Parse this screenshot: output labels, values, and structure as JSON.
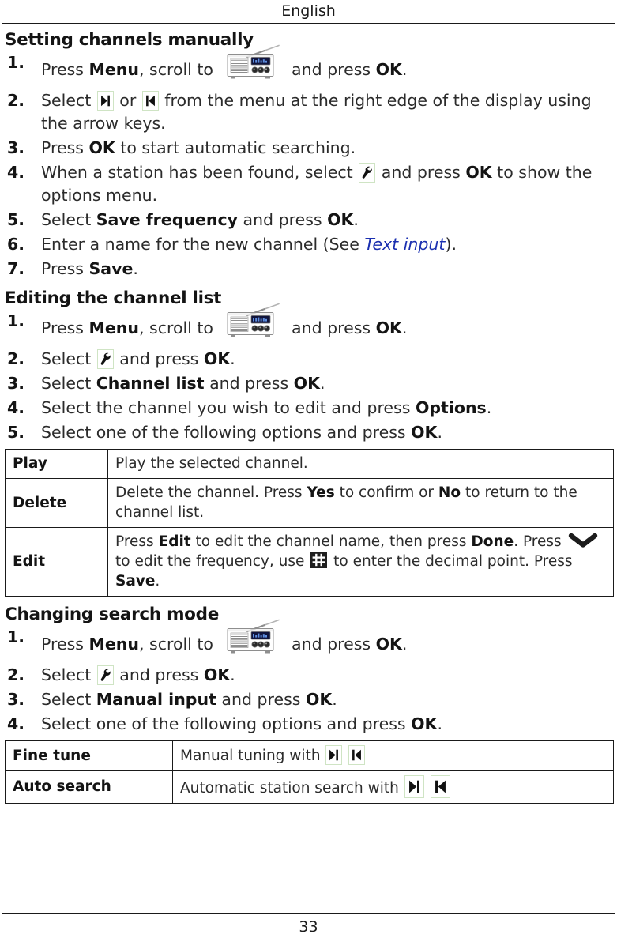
{
  "header": {
    "running_head": "English"
  },
  "footer": {
    "page_number": "33"
  },
  "colors": {
    "text": "#2b2b2b",
    "heading": "#141414",
    "link": "#1a2fb0",
    "icon_frame": "#cfe4c4",
    "rule": "#1a1a1a"
  },
  "sections": [
    {
      "title": "Setting channels manually",
      "steps": [
        {
          "num": "1.",
          "parts": [
            {
              "t": "Press "
            },
            {
              "t": "Menu",
              "bold": true
            },
            {
              "t": ", scroll to "
            },
            {
              "icon": "radio-icon"
            },
            {
              "t": " and press "
            },
            {
              "t": "OK",
              "bold": true
            },
            {
              "t": "."
            }
          ]
        },
        {
          "num": "2.",
          "parts": [
            {
              "t": "Select "
            },
            {
              "icon": "skip-forward-icon"
            },
            {
              "t": " or "
            },
            {
              "icon": "skip-back-icon"
            },
            {
              "t": " from the menu at the right edge of the display using the arrow keys."
            }
          ]
        },
        {
          "num": "3.",
          "parts": [
            {
              "t": "Press "
            },
            {
              "t": "OK",
              "bold": true
            },
            {
              "t": " to start automatic searching."
            }
          ]
        },
        {
          "num": "4.",
          "parts": [
            {
              "t": "When a station has been found, select "
            },
            {
              "icon": "wrench-icon"
            },
            {
              "t": " and press "
            },
            {
              "t": "OK",
              "bold": true
            },
            {
              "t": " to show the options menu."
            }
          ]
        },
        {
          "num": "5.",
          "parts": [
            {
              "t": "Select "
            },
            {
              "t": "Save frequency",
              "bold": true
            },
            {
              "t": " and press "
            },
            {
              "t": "OK",
              "bold": true
            },
            {
              "t": "."
            }
          ]
        },
        {
          "num": "6.",
          "parts": [
            {
              "t": "Enter a name for the new channel (See "
            },
            {
              "t": "Text input",
              "link": true
            },
            {
              "t": ")."
            }
          ]
        },
        {
          "num": "7.",
          "parts": [
            {
              "t": "Press "
            },
            {
              "t": "Save",
              "bold": true
            },
            {
              "t": "."
            }
          ]
        }
      ]
    },
    {
      "title": "Editing the channel list",
      "steps": [
        {
          "num": "1.",
          "parts": [
            {
              "t": "Press "
            },
            {
              "t": "Menu",
              "bold": true
            },
            {
              "t": ", scroll to "
            },
            {
              "icon": "radio-icon"
            },
            {
              "t": " and press "
            },
            {
              "t": "OK",
              "bold": true
            },
            {
              "t": "."
            }
          ]
        },
        {
          "num": "2.",
          "parts": [
            {
              "t": "Select "
            },
            {
              "icon": "wrench-icon"
            },
            {
              "t": " and press "
            },
            {
              "t": "OK",
              "bold": true
            },
            {
              "t": "."
            }
          ]
        },
        {
          "num": "3.",
          "parts": [
            {
              "t": "Select "
            },
            {
              "t": "Channel list",
              "bold": true
            },
            {
              "t": " and press "
            },
            {
              "t": "OK",
              "bold": true
            },
            {
              "t": "."
            }
          ]
        },
        {
          "num": "4.",
          "parts": [
            {
              "t": "Select the channel you wish to edit and press "
            },
            {
              "t": "Options",
              "bold": true
            },
            {
              "t": "."
            }
          ]
        },
        {
          "num": "5.",
          "parts": [
            {
              "t": "Select one of the following options and press "
            },
            {
              "t": "OK",
              "bold": true
            },
            {
              "t": "."
            }
          ]
        }
      ],
      "table": {
        "rows": [
          {
            "key": "Play",
            "parts": [
              {
                "t": "Play the selected channel."
              }
            ]
          },
          {
            "key": "Delete",
            "parts": [
              {
                "t": "Delete the channel. Press "
              },
              {
                "t": "Yes",
                "bold": true
              },
              {
                "t": " to confirm or "
              },
              {
                "t": "No",
                "bold": true
              },
              {
                "t": " to return to the channel list."
              }
            ]
          },
          {
            "key": "Edit",
            "parts": [
              {
                "t": "Press "
              },
              {
                "t": "Edit",
                "bold": true
              },
              {
                "t": " to edit the channel name, then press "
              },
              {
                "t": "Done",
                "bold": true
              },
              {
                "t": ". Press "
              },
              {
                "icon": "chevron-down-icon"
              },
              {
                "t": " to edit the frequency, use "
              },
              {
                "icon": "hash-key-icon"
              },
              {
                "t": " to enter the decimal point. Press "
              },
              {
                "t": "Save",
                "bold": true
              },
              {
                "t": "."
              }
            ]
          }
        ]
      }
    },
    {
      "title": "Changing search mode",
      "steps": [
        {
          "num": "1.",
          "parts": [
            {
              "t": "Press "
            },
            {
              "t": "Menu",
              "bold": true
            },
            {
              "t": ", scroll to "
            },
            {
              "icon": "radio-icon"
            },
            {
              "t": " and press "
            },
            {
              "t": "OK",
              "bold": true
            },
            {
              "t": "."
            }
          ]
        },
        {
          "num": "2.",
          "parts": [
            {
              "t": "Select "
            },
            {
              "icon": "wrench-icon"
            },
            {
              "t": " and press "
            },
            {
              "t": "OK",
              "bold": true
            },
            {
              "t": "."
            }
          ]
        },
        {
          "num": "3.",
          "parts": [
            {
              "t": "Select "
            },
            {
              "t": "Manual input",
              "bold": true
            },
            {
              "t": " and press "
            },
            {
              "t": "OK",
              "bold": true
            },
            {
              "t": "."
            }
          ]
        },
        {
          "num": "4.",
          "parts": [
            {
              "t": "Select one of the following options and press "
            },
            {
              "t": "OK",
              "bold": true
            },
            {
              "t": "."
            }
          ]
        }
      ],
      "table": {
        "rows": [
          {
            "key": "Fine tune",
            "parts": [
              {
                "t": "Manual tuning with "
              },
              {
                "icon": "skip-forward-icon"
              },
              {
                "t": "  "
              },
              {
                "icon": "skip-back-icon"
              }
            ]
          },
          {
            "key": "Auto search",
            "parts": [
              {
                "t": "Automatic station search with "
              },
              {
                "icon": "skip-forward-icon-lg"
              },
              {
                "t": "  "
              },
              {
                "icon": "skip-back-icon-lg"
              }
            ]
          }
        ]
      }
    }
  ]
}
